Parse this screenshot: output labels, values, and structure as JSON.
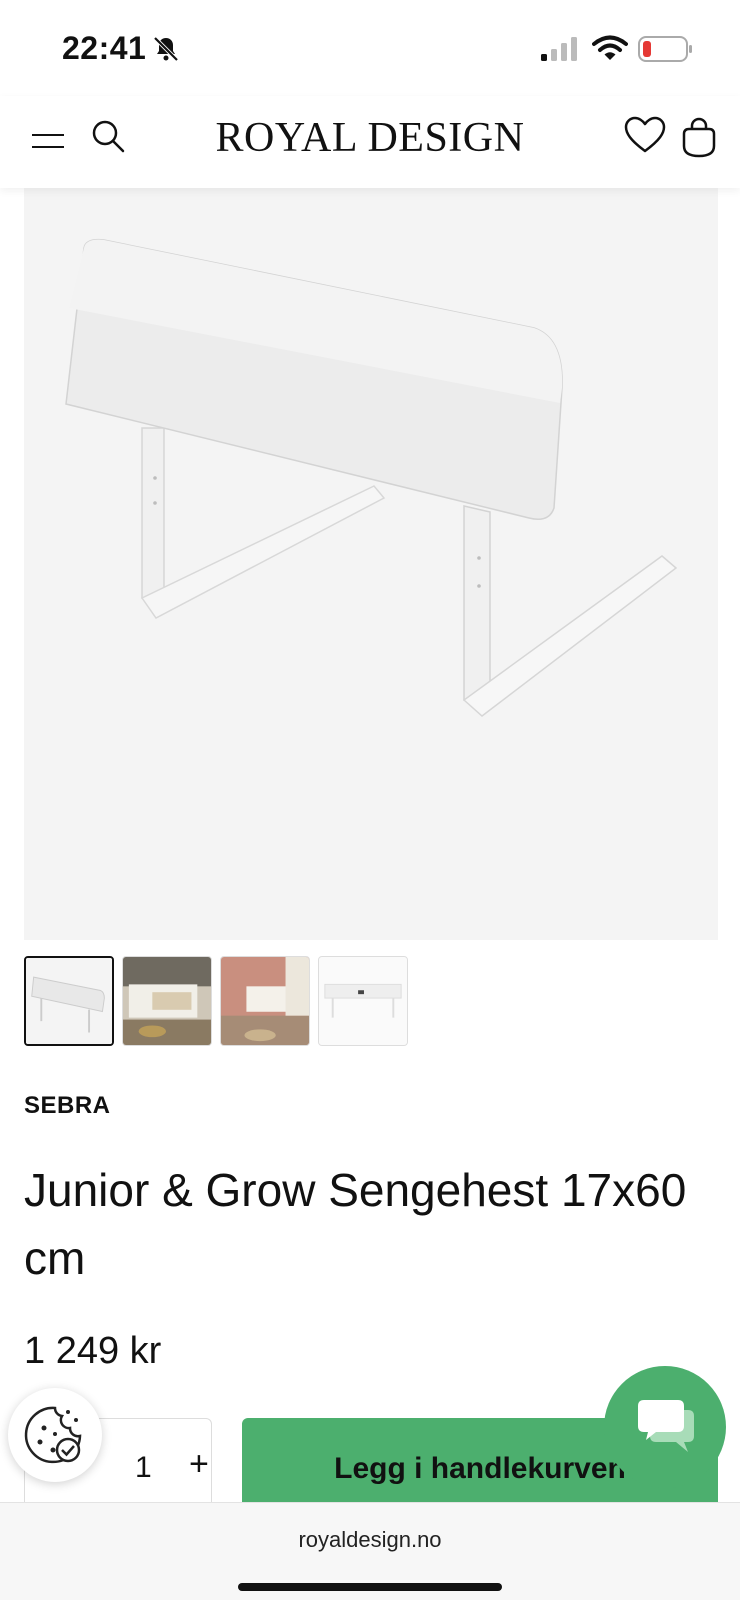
{
  "status_bar": {
    "time": "22:41",
    "icons": [
      "bell-slash-icon",
      "signal-icon",
      "wifi-icon",
      "battery-low-icon"
    ],
    "battery_color": "#e53935"
  },
  "header": {
    "brand": "ROYAL DESIGN",
    "icons": [
      "menu-icon",
      "search-icon",
      "heart-icon",
      "bag-icon"
    ]
  },
  "gallery": {
    "thumbnails": [
      "thumb-1",
      "thumb-2",
      "thumb-3",
      "thumb-4"
    ],
    "active_index": 0
  },
  "product": {
    "brand": "SEBRA",
    "title": "Junior & Grow Sengehest 17x60 cm",
    "price": "1 249 kr"
  },
  "purchase": {
    "quantity": "1",
    "plus_label": "+",
    "add_to_cart_label": "Legg i handlekurven"
  },
  "browser": {
    "url": "royaldesign.no"
  },
  "colors": {
    "accent_green": "#4caf6e",
    "image_bg": "#f4f4f4"
  }
}
